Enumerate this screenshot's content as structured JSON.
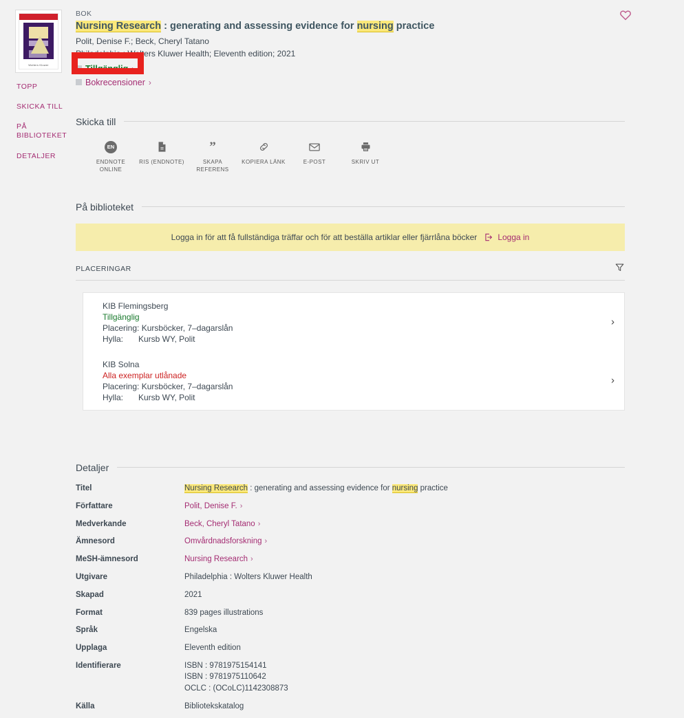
{
  "record": {
    "type_label": "BOK",
    "title_highlight": "Nursing Research",
    "title_rest": " : generating and assessing evidence for ",
    "title_highlight2": "nursing",
    "title_tail": " practice",
    "authors": "Polit, Denise F.; Beck, Cheryl Tatano",
    "publication": "Philadelphia : Wolters Kluwer Health; Eleventh edition; 2021",
    "availability": "Tillgänglig",
    "reviews_link": "Bokrecensioner",
    "chevron": "›",
    "favorite_icon": "heart-icon"
  },
  "sidenav": {
    "items": [
      {
        "label": "TOPP"
      },
      {
        "label": "SKICKA TILL"
      },
      {
        "label": "PÅ BIBLIOTEKET"
      },
      {
        "label": "DETALJER"
      }
    ]
  },
  "send_to": {
    "heading": "Skicka till",
    "items": [
      {
        "label": "ENDNOTE ONLINE",
        "icon": "endnote-icon",
        "badge": "EN"
      },
      {
        "label": "RIS (ENDNOTE)",
        "icon": "document-icon"
      },
      {
        "label": "SKAPA REFERENS",
        "icon": "quote-icon"
      },
      {
        "label": "KOPIERA LÄNK",
        "icon": "link-icon"
      },
      {
        "label": "E-POST",
        "icon": "envelope-icon"
      },
      {
        "label": "SKRIV UT",
        "icon": "printer-icon"
      }
    ]
  },
  "library": {
    "heading": "På biblioteket",
    "login_message": "Logga in för att få fullständiga träffar och för att beställa artiklar eller fjärrlåna böcker",
    "login_label": "Logga in",
    "placements_label": "PLACERINGAR",
    "filter_icon": "filter-icon",
    "locations": [
      {
        "name": "KIB Flemingsberg",
        "status": "Tillgänglig",
        "status_type": "ok",
        "placement_label": "Placering:",
        "placement_value": "Kursböcker, 7–dagarslån",
        "shelf_label": "Hylla:",
        "shelf_value": "Kursb WY, Polit",
        "chevron": "›"
      },
      {
        "name": "KIB Solna",
        "status": "Alla exemplar utlånade",
        "status_type": "no",
        "placement_label": "Placering:",
        "placement_value": "Kursböcker, 7–dagarslån",
        "shelf_label": "Hylla:",
        "shelf_value": "Kursb WY, Polit",
        "chevron": "›"
      }
    ]
  },
  "details": {
    "heading": "Detaljer",
    "rows": [
      {
        "key": "Titel",
        "type": "title"
      },
      {
        "key": "Författare",
        "value": "Polit, Denise F.",
        "type": "link"
      },
      {
        "key": "Medverkande",
        "value": "Beck, Cheryl Tatano",
        "type": "link"
      },
      {
        "key": "Ämnesord",
        "value": "Omvårdnadsforskning",
        "type": "link"
      },
      {
        "key": "MeSH-ämnesord",
        "value": "Nursing Research",
        "type": "link"
      },
      {
        "key": "Utgivare",
        "value": "Philadelphia : Wolters Kluwer Health",
        "type": "text"
      },
      {
        "key": "Skapad",
        "value": "2021",
        "type": "text"
      },
      {
        "key": "Format",
        "value": "839 pages illustrations",
        "type": "text"
      },
      {
        "key": "Språk",
        "value": "Engelska",
        "type": "text"
      },
      {
        "key": "Upplaga",
        "value": "Eleventh edition",
        "type": "text"
      },
      {
        "key": "Identifierare",
        "type": "multi",
        "values": [
          "ISBN : 9781975154141",
          "ISBN : 9781975110642",
          "OCLC : (OCoLC)1142308873"
        ]
      },
      {
        "key": "Källa",
        "value": "Bibliotekskatalog",
        "type": "text"
      }
    ]
  },
  "colors": {
    "background": "#f2f2f2",
    "link": "#a42c72",
    "title": "#3f5661",
    "highlight": "#fbe87a",
    "available": "#1a7a2e",
    "unavailable": "#cc2222",
    "banner": "#f6edac",
    "annotation": "#e8221e"
  }
}
